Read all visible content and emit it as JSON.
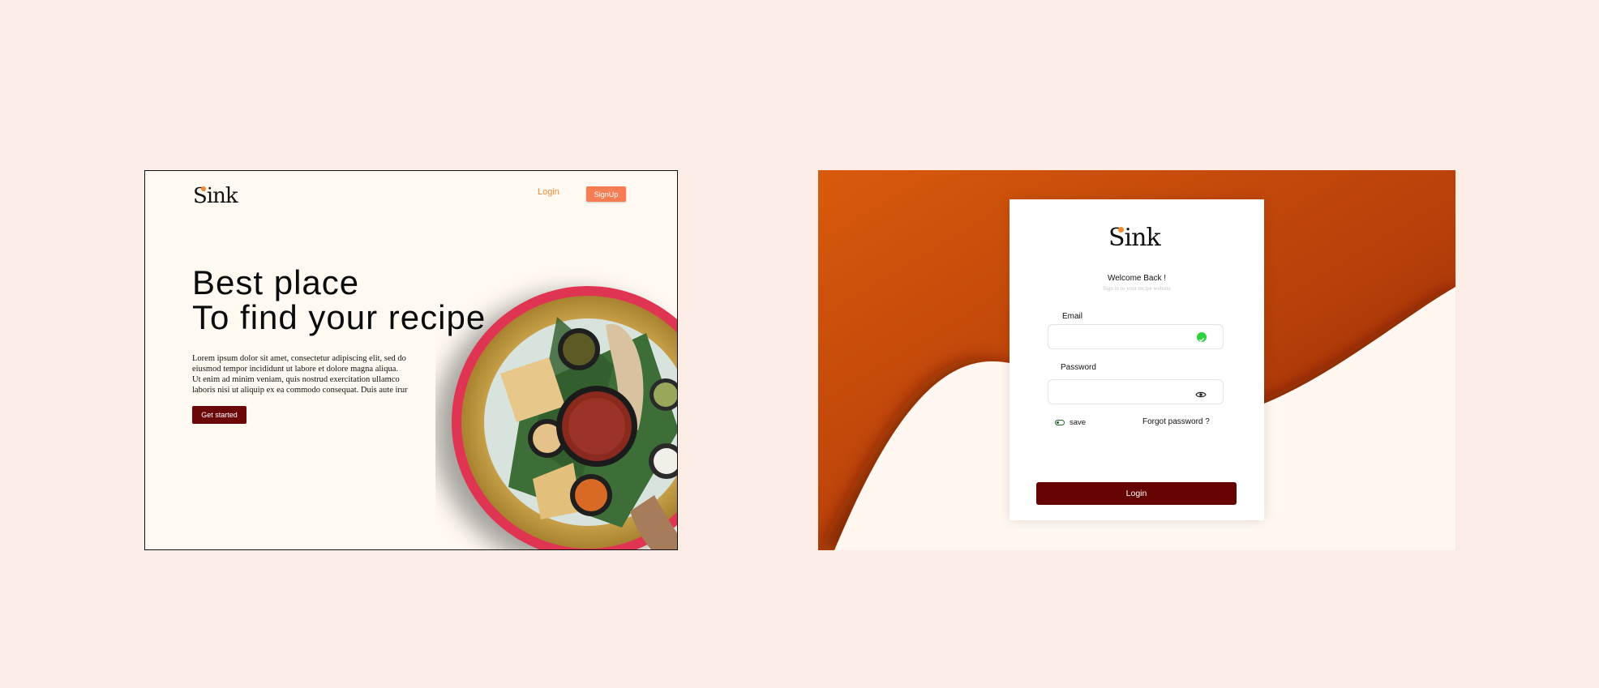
{
  "landing": {
    "brand": "Sink",
    "nav": {
      "login": "Login",
      "signup": "SignUp"
    },
    "headline": "Best place\nTo find your recipe",
    "body": "Lorem ipsum dolor sit amet, consectetur adipiscing elit, sed do\n eiusmod tempor incididunt ut labore et dolore magna aliqua.\n Ut enim ad minim veniam, quis nostrud exercitation ullamco\n laboris nisi ut aliquip ex ea commodo consequat. Duis aute irur",
    "cta": "Get started"
  },
  "login": {
    "brand": "Sink",
    "welcome": "Welcome Back !",
    "subtitle": "Sign in to your recipe website",
    "email_label": "Email",
    "email_value": "",
    "password_label": "Password",
    "password_value": "",
    "save_label": "save",
    "forgot_label": "Forgot password ?",
    "submit": "Login"
  },
  "colors": {
    "page_bg": "#fbede6",
    "accent_orange": "#f47d54",
    "primary_dark_red": "#660404",
    "check_green": "#2bd33f",
    "login_bg_orange": "#c84a0a"
  },
  "icons": [
    "check-circle-icon",
    "eye-icon",
    "toggle-switch-icon",
    "food-platter-image"
  ]
}
